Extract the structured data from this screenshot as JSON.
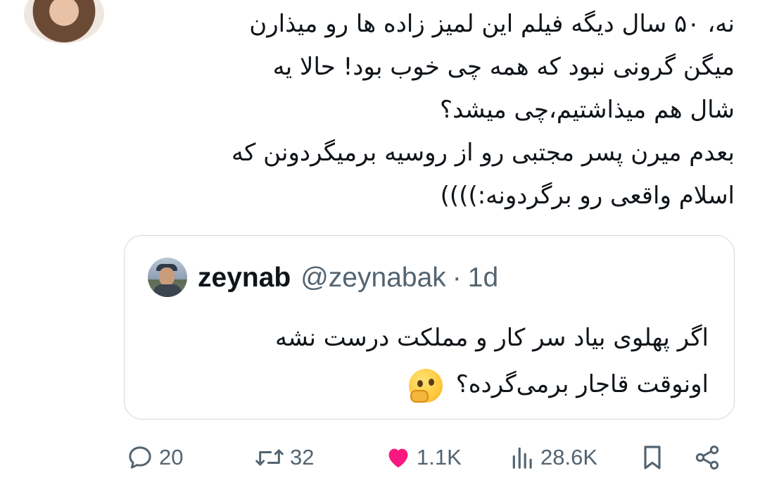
{
  "tweet": {
    "text": "نه، ۵۰ سال دیگه فیلم این لمیز زاده ها رو میذارن\nمیگن گرونی نبود که همه چی خوب بود! حالا یه\nشال هم میذاشتیم،چی میشد؟\nبعدم میرن پسر مجتبی رو از روسیه برمیگردونن که\nاسلام واقعی رو برگردونه:))))"
  },
  "quote": {
    "name": "zeynab",
    "handle": "@zeynabak",
    "dot": "·",
    "time": "1d",
    "line1": "اگر پهلوی بیاد سر کار و مملکت درست نشه",
    "line2": "اونوقت قاجار برمی‌گرده؟",
    "emoji": "thinking-face"
  },
  "actions": {
    "replies": "20",
    "retweets": "32",
    "likes": "1.1K",
    "views": "28.6K",
    "like_color": "#f91880",
    "icon_color": "#536471"
  }
}
